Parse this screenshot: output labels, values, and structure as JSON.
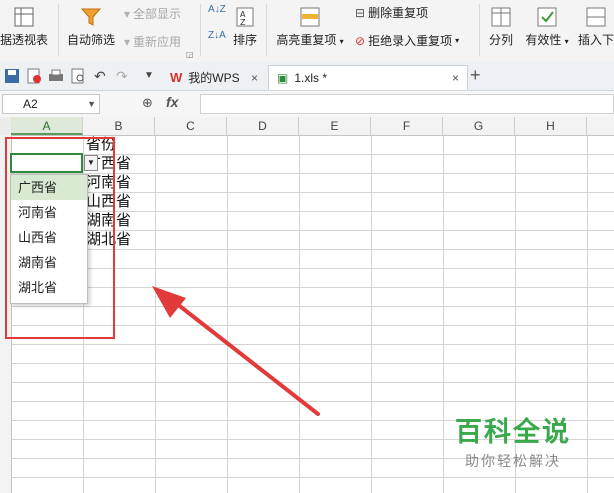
{
  "ribbon": {
    "pivot_label": "据透视表",
    "autofilter_label": "自动筛选",
    "show_all_label": "全部显示",
    "reapply_label": "重新应用",
    "sort_label": "排序",
    "highlight_dup_label": "高亮重复项",
    "delete_dup_label": "删除重复项",
    "reject_dup_label": "拒绝录入重复项",
    "split_label": "分列",
    "validity_label": "有效性",
    "insert_label": "插入下"
  },
  "tabs": [
    {
      "label": "我的WPS"
    },
    {
      "label": "1.xls *"
    }
  ],
  "formula_bar": {
    "name_box": "A2",
    "fx": "fx",
    "value": ""
  },
  "columns": [
    "A",
    "B",
    "C",
    "D",
    "E",
    "F",
    "G",
    "H"
  ],
  "cells": {
    "b1": "省份",
    "b2": "广西省",
    "b3": "河南省",
    "b4": "山西省",
    "b5": "湖南省",
    "b6": "湖北省"
  },
  "dropdown": {
    "options": [
      "广西省",
      "河南省",
      "山西省",
      "湖南省",
      "湖北省"
    ],
    "highlighted": "广西省"
  },
  "watermark": {
    "title": "百科全说",
    "subtitle": "助你轻松解决"
  },
  "colors": {
    "accent_green": "#2e8b3b",
    "annotation_red": "#e23a3a",
    "watermark_green": "#3aa94b"
  }
}
